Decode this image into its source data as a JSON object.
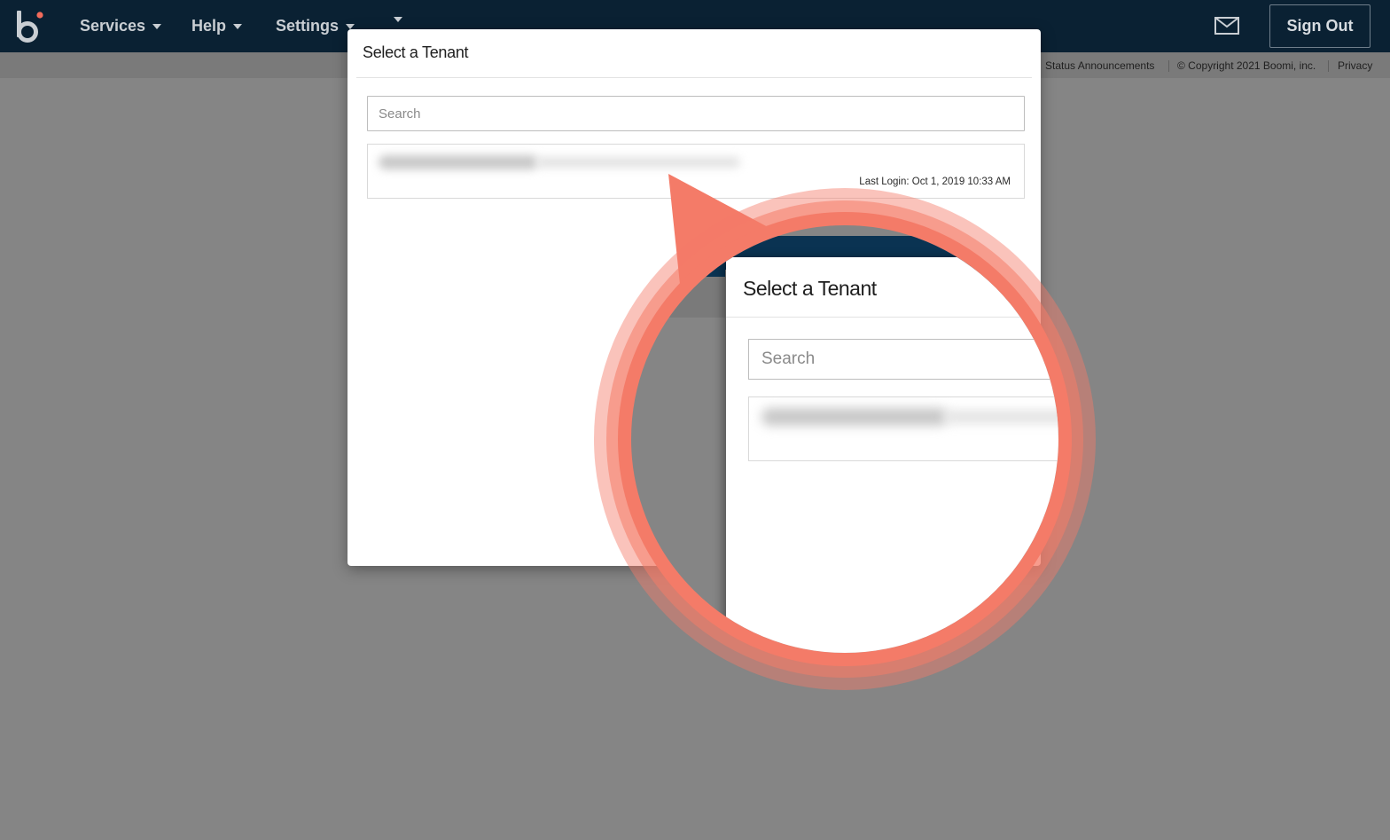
{
  "nav": {
    "items": [
      {
        "label": "Services"
      },
      {
        "label": "Help"
      },
      {
        "label": "Settings"
      }
    ],
    "sign_out": "Sign Out"
  },
  "footer_links": {
    "status": "Status Announcements",
    "copyright": "© Copyright 2021 Boomi, inc.",
    "privacy": "Privacy"
  },
  "dialog": {
    "title": "Select a Tenant",
    "search_placeholder": "Search",
    "tenants": [
      {
        "last_login": "Last Login: Oct 1, 2019 10:33 AM"
      }
    ]
  },
  "zoom_callout": {
    "title": "Select a Tenant",
    "search_placeholder": "Search"
  },
  "colors": {
    "nav_bg": "#0a2133",
    "accent": "#f47b68",
    "backdrop": "#858585"
  }
}
